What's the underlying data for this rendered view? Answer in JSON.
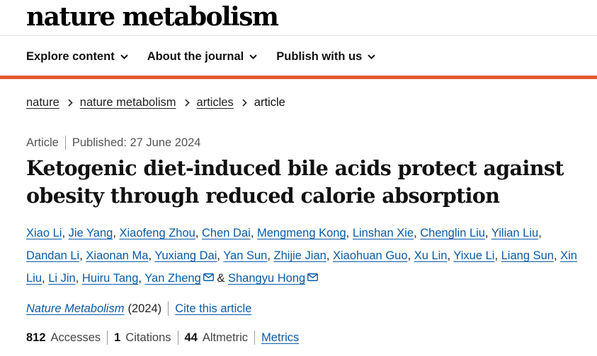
{
  "brand": "nature metabolism",
  "nav": {
    "items": [
      {
        "label": "Explore content"
      },
      {
        "label": "About the journal"
      },
      {
        "label": "Publish with us"
      }
    ]
  },
  "breadcrumb": {
    "items": [
      "nature",
      "nature metabolism",
      "articles"
    ],
    "current": "article"
  },
  "article": {
    "type": "Article",
    "published": "Published: 27 June 2024",
    "title": "Ketogenic diet-induced bile acids protect against obesity through reduced calorie absorption",
    "authors": [
      "Xiao Li",
      "Jie Yang",
      "Xiaofeng Zhou",
      "Chen Dai",
      "Mengmeng Kong",
      "Linshan Xie",
      "Chenglin Liu",
      "Yilian Liu",
      "Dandan Li",
      "Xiaonan Ma",
      "Yuxiang Dai",
      "Yan Sun",
      "Zhijie Jian",
      "Xiaohuan Guo",
      "Xu Lin",
      "Yixue Li",
      "Liang Sun",
      "Xin Liu",
      "Li Jin",
      "Huiru Tang",
      "Yan Zheng",
      "Shangyu Hong"
    ],
    "ampersand": "&",
    "journal": "Nature Metabolism",
    "year": "(2024)",
    "cite_label": "Cite this article"
  },
  "metrics": {
    "accesses_value": "812",
    "accesses_label": "Accesses",
    "citations_value": "1",
    "citations_label": "Citations",
    "altmetric_value": "44",
    "altmetric_label": "Altmetric",
    "metrics_link": "Metrics"
  },
  "colors": {
    "accent_bar": "#e4572e",
    "link": "#0a5ca8"
  },
  "icons": {
    "nav_dropdown": "chevron-down-icon",
    "breadcrumb_separator": "chevron-right-icon",
    "author_contact": "envelope-icon"
  }
}
